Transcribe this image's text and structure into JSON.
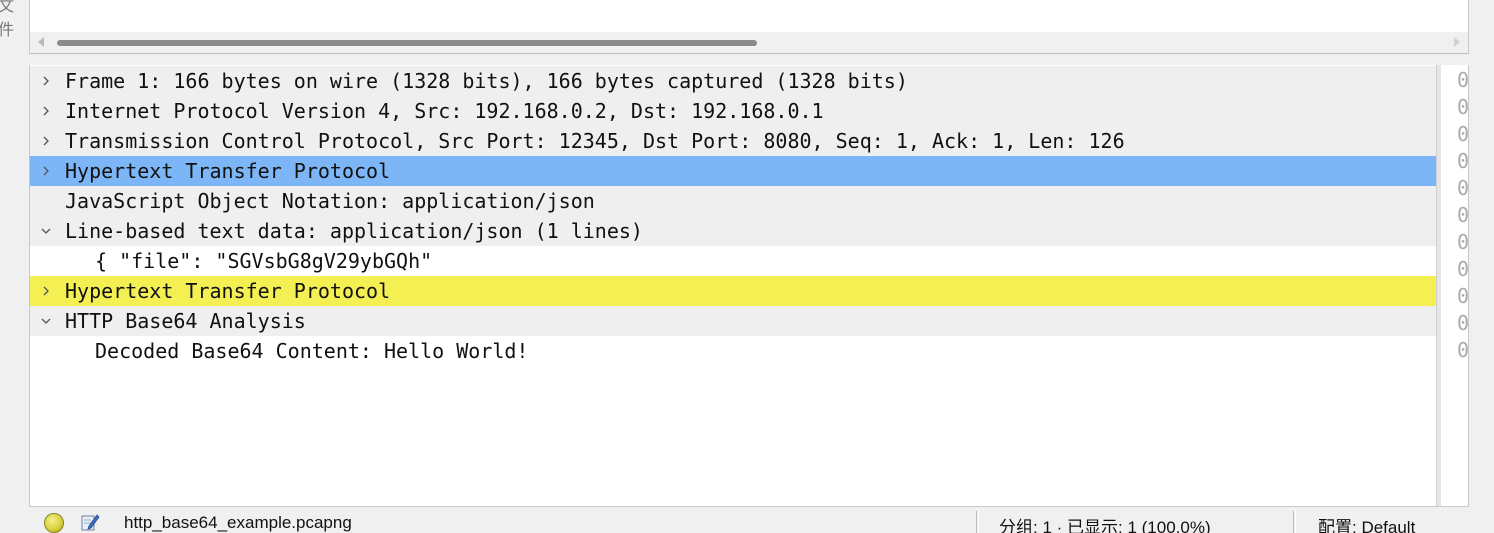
{
  "corner_glyph": "文件",
  "details": {
    "rows": [
      {
        "text": "Frame 1: 166 bytes on wire (1328 bits), 166 bytes captured (1328 bits)",
        "expander": "collapsed",
        "indent": 0,
        "style": "alt"
      },
      {
        "text": "Internet Protocol Version 4, Src: 192.168.0.2, Dst: 192.168.0.1",
        "expander": "collapsed",
        "indent": 0,
        "style": "alt"
      },
      {
        "text": "Transmission Control Protocol, Src Port: 12345, Dst Port: 8080, Seq: 1, Ack: 1, Len: 126",
        "expander": "collapsed",
        "indent": 0,
        "style": "alt"
      },
      {
        "text": "Hypertext Transfer Protocol",
        "expander": "collapsed",
        "indent": 0,
        "style": "selected-blue"
      },
      {
        "text": "JavaScript Object Notation: application/json",
        "expander": "none",
        "indent": 0,
        "style": "alt"
      },
      {
        "text": "Line-based text data: application/json (1 lines)",
        "expander": "expanded",
        "indent": 0,
        "style": "alt"
      },
      {
        "text": "{ \"file\": \"SGVsbG8gV29ybGQh\"",
        "expander": "none",
        "indent": 1,
        "style": "plain"
      },
      {
        "text": "Hypertext Transfer Protocol",
        "expander": "collapsed",
        "indent": 0,
        "style": "highlight-yellow"
      },
      {
        "text": "HTTP Base64 Analysis",
        "expander": "expanded",
        "indent": 0,
        "style": "alt"
      },
      {
        "text": "Decoded Base64 Content: Hello World!",
        "expander": "none",
        "indent": 1,
        "style": "plain"
      }
    ]
  },
  "bytes_pane": {
    "visible_chars": [
      "0",
      "0",
      "0",
      "0",
      "0",
      "0",
      "0",
      "0",
      "0",
      "0",
      "0"
    ]
  },
  "status_bar": {
    "file_name": "http_base64_example.pcapng",
    "packets_text": "分组: 1 · 已显示: 1 (100.0%)",
    "profile_text": "配置: Default"
  },
  "colors": {
    "selected_blue": "#7db6f6",
    "highlight_yellow": "#f4f053",
    "alt_row": "#efefef"
  }
}
